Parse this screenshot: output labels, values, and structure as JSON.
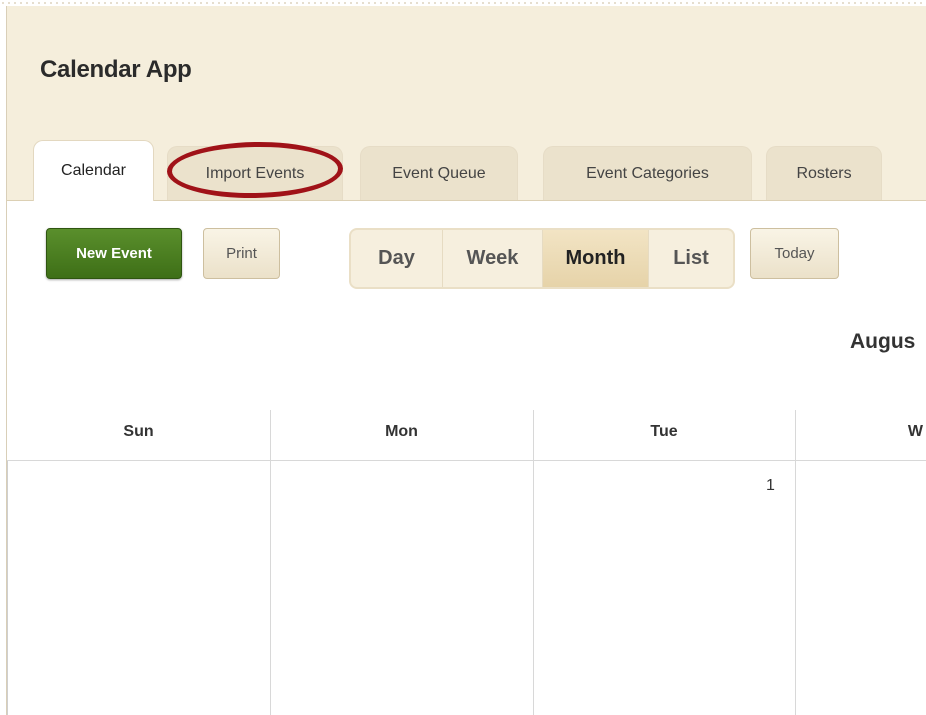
{
  "app": {
    "title": "Calendar App"
  },
  "tabs": [
    {
      "label": "Calendar",
      "active": true
    },
    {
      "label": "Import Events",
      "active": false,
      "highlighted": true
    },
    {
      "label": "Event Queue",
      "active": false
    },
    {
      "label": "Event Categories",
      "active": false
    },
    {
      "label": "Rosters",
      "active": false
    }
  ],
  "toolbar": {
    "new_event_label": "New Event",
    "print_label": "Print",
    "today_label": "Today",
    "views": [
      "Day",
      "Week",
      "Month",
      "List"
    ],
    "active_view": "Month"
  },
  "calendar": {
    "month_title": "Augus",
    "weekdays": [
      "Sun",
      "Mon",
      "Tue",
      "W"
    ],
    "first_row_days": [
      "",
      "",
      "1",
      ""
    ]
  },
  "colors": {
    "header_bg": "#f5eedc",
    "new_event_green": "#4a7d22",
    "highlight_ring": "#a01218"
  }
}
